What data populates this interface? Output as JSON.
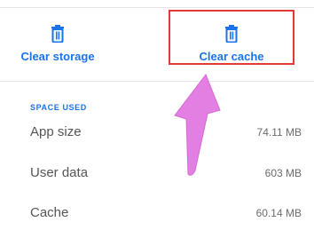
{
  "actions": {
    "clear_storage": {
      "label": "Clear storage",
      "icon": "trash-icon"
    },
    "clear_cache": {
      "label": "Clear cache",
      "icon": "trash-icon"
    }
  },
  "space_used": {
    "header": "SPACE USED",
    "rows": [
      {
        "label": "App size",
        "value": "74.11 MB"
      },
      {
        "label": "User data",
        "value": "603 MB"
      },
      {
        "label": "Cache",
        "value": "60.14 MB"
      }
    ]
  },
  "colors": {
    "accent": "#1a73e8",
    "highlight_box": "#e53935",
    "annotation_arrow": "#e37fe2"
  }
}
